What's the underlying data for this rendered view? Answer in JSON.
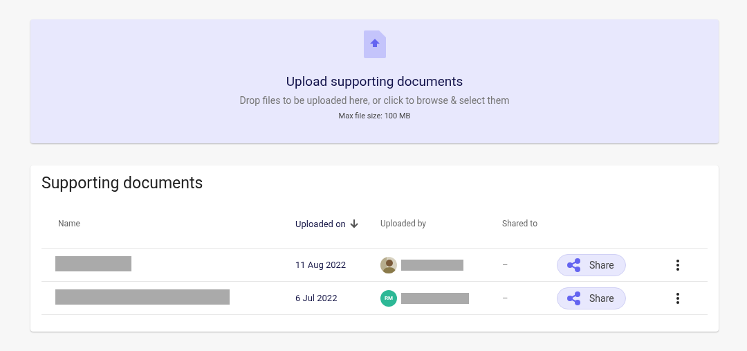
{
  "upload": {
    "title": "Upload supporting documents",
    "hint": "Drop files to be uploaded here, or click to browse & select them",
    "limit": "Max file size: 100 MB"
  },
  "documents": {
    "title": "Supporting documents",
    "columns": [
      {
        "label": "Name",
        "sorted": false
      },
      {
        "label": "Uploaded on",
        "sorted": true
      },
      {
        "label": "Uploaded by",
        "sorted": false
      },
      {
        "label": "Shared to",
        "sorted": false
      }
    ],
    "rows": [
      {
        "uploaded_on": "11 Aug 2022",
        "shared_to": "–",
        "share": "Share"
      },
      {
        "uploaded_on": "6 Jul 2022",
        "avatar": {
          "kind": "initials",
          "initials": "RM",
          "color": "#2db896"
        },
        "shared_to": "–",
        "share": "Share"
      }
    ]
  }
}
